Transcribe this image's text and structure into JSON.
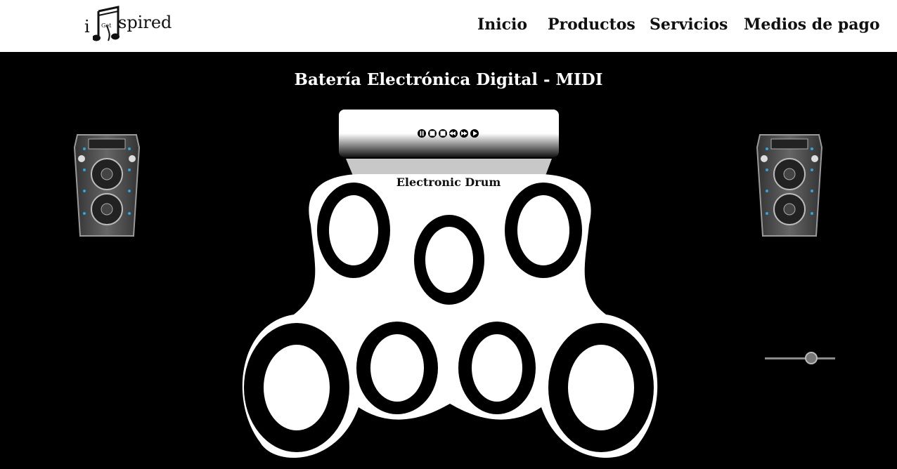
{
  "header": {
    "logo": {
      "prefix": "i",
      "small": "Get",
      "suffix": "spired"
    },
    "nav": [
      {
        "label": "Inicio"
      },
      {
        "label": "Productos"
      },
      {
        "label": "Servicios"
      },
      {
        "label": "Medios de pago"
      }
    ]
  },
  "main": {
    "title": "Batería Electrónica Digital - MIDI",
    "drum_label": "Electronic Drum",
    "controls": [
      "pause-icon",
      "stop-icon",
      "record-icon",
      "rewind-icon",
      "fast-forward-icon",
      "play-icon"
    ],
    "volume_level": 0.7
  },
  "colors": {
    "background": "#000000",
    "header": "#ffffff",
    "speaker_accent": "#2aa8d8"
  }
}
